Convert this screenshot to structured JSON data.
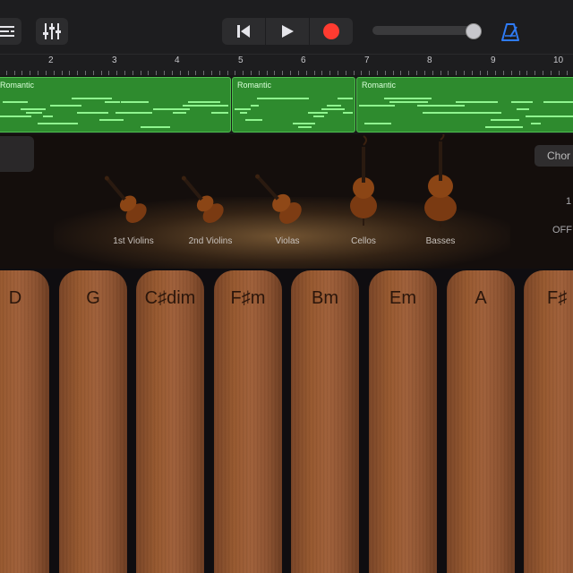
{
  "toolbar": {
    "tracks_icon": "tracks-list-icon",
    "mixer_icon": "mixer-sliders-icon",
    "rewind_icon": "rewind-to-start-icon",
    "play_icon": "play-icon",
    "record_icon": "record-icon",
    "metronome_icon": "metronome-icon",
    "volume_level": 0.93,
    "colors": {
      "record": "#ff3b30",
      "metronome": "#2f7cf6"
    }
  },
  "ruler": {
    "bars": [
      "2",
      "3",
      "4",
      "5",
      "6",
      "7",
      "8",
      "9",
      "10"
    ]
  },
  "track": {
    "regions": [
      {
        "label": "Romantic"
      },
      {
        "label": "Romantic"
      },
      {
        "label": "Romantic"
      }
    ],
    "colors": {
      "region": "#2e8b2e",
      "note": "#8ff58f"
    }
  },
  "stage": {
    "chords_button": "Chor",
    "side_value_1": "1",
    "side_value_2": "OFF",
    "instruments": [
      {
        "name": "1st Violins",
        "icon": "violin-icon"
      },
      {
        "name": "2nd Violins",
        "icon": "violin-icon"
      },
      {
        "name": "Violas",
        "icon": "viola-icon"
      },
      {
        "name": "Cellos",
        "icon": "cello-icon"
      },
      {
        "name": "Basses",
        "icon": "double-bass-icon"
      }
    ]
  },
  "chords": [
    "D",
    "G",
    "C♯dim",
    "F♯m",
    "Bm",
    "Em",
    "A",
    "F♯"
  ]
}
